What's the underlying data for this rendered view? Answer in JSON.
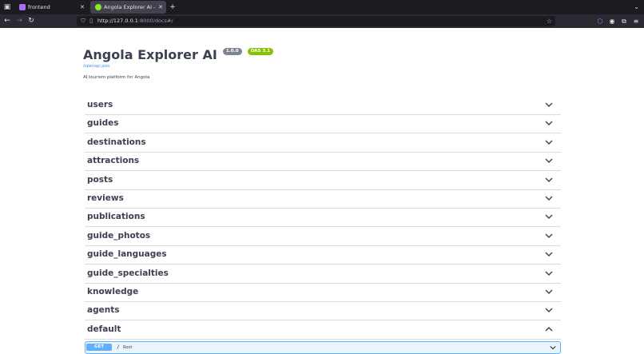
{
  "browser": {
    "tabs": [
      {
        "title": "frontend",
        "favicon_color": "#a86cf5",
        "active": false
      },
      {
        "title": "Angola Explorer AI - Swa",
        "favicon_color": "#85ea2d",
        "active": true
      }
    ],
    "url_host": "http://127.0.0.1",
    "url_rest": ":8000/docs#/"
  },
  "api": {
    "title": "Angola Explorer AI",
    "version": "1.0.0",
    "oas": "OAS 3.1",
    "spec_link": "/openapi.json",
    "description": "AI tourism platform for Angola"
  },
  "tags": [
    {
      "label": "users",
      "expanded": false
    },
    {
      "label": "guides",
      "expanded": false
    },
    {
      "label": "destinations",
      "expanded": false
    },
    {
      "label": "attractions",
      "expanded": false
    },
    {
      "label": "posts",
      "expanded": false
    },
    {
      "label": "reviews",
      "expanded": false
    },
    {
      "label": "publications",
      "expanded": false
    },
    {
      "label": "guide_photos",
      "expanded": false
    },
    {
      "label": "guide_languages",
      "expanded": false
    },
    {
      "label": "guide_specialties",
      "expanded": false
    },
    {
      "label": "knowledge",
      "expanded": false
    },
    {
      "label": "agents",
      "expanded": false
    },
    {
      "label": "default",
      "expanded": true
    }
  ],
  "operation": {
    "method": "GET",
    "path": "/",
    "summary": "Root"
  },
  "colors": {
    "get_blue": "#61affe",
    "text": "#3b4151",
    "oas_green": "#89bf04"
  }
}
